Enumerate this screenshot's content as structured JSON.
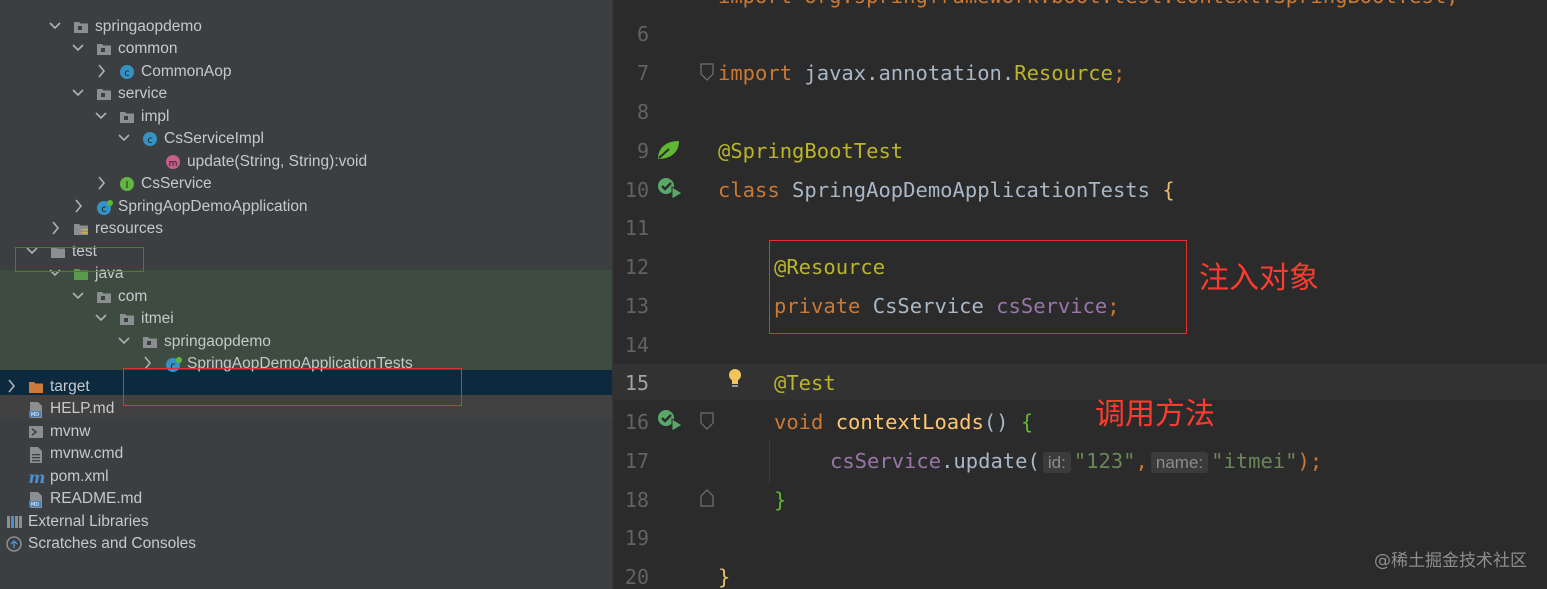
{
  "tree": {
    "items": [
      {
        "label": "springaopdemo",
        "icon": "package-icon",
        "expanded": true
      },
      {
        "label": "common",
        "icon": "package-icon",
        "expanded": true
      },
      {
        "label": "CommonAop",
        "icon": "class-icon",
        "expanded": false
      },
      {
        "label": "service",
        "icon": "package-icon",
        "expanded": true
      },
      {
        "label": "impl",
        "icon": "package-icon",
        "expanded": true
      },
      {
        "label": "CsServiceImpl",
        "icon": "class-icon",
        "expanded": true
      },
      {
        "label": "update(String, String):void",
        "icon": "method-icon"
      },
      {
        "label": "CsService",
        "icon": "interface-icon",
        "expanded": false
      },
      {
        "label": "SpringAopDemoApplication",
        "icon": "spring-boot-class-icon",
        "expanded": false
      },
      {
        "label": "resources",
        "icon": "resources-folder-icon",
        "expanded": false
      },
      {
        "label": "test",
        "icon": "folder-icon",
        "expanded": true
      },
      {
        "label": "java",
        "icon": "test-source-folder-icon",
        "expanded": true
      },
      {
        "label": "com",
        "icon": "package-icon",
        "expanded": true
      },
      {
        "label": "itmei",
        "icon": "package-icon",
        "expanded": true
      },
      {
        "label": "springaopdemo",
        "icon": "package-icon",
        "expanded": true
      },
      {
        "label": "SpringAopDemoApplicationTests",
        "icon": "test-class-icon",
        "expanded": false
      },
      {
        "label": "target",
        "icon": "excluded-folder-icon",
        "expanded": false
      },
      {
        "label": "HELP.md",
        "icon": "markdown-file-icon"
      },
      {
        "label": "mvnw",
        "icon": "shell-script-icon"
      },
      {
        "label": "mvnw.cmd",
        "icon": "text-file-icon"
      },
      {
        "label": "pom.xml",
        "icon": "maven-icon"
      },
      {
        "label": "README.md",
        "icon": "markdown-file-icon"
      },
      {
        "label": "External Libraries",
        "icon": "libraries-icon",
        "expanded": false
      },
      {
        "label": "Scratches and Consoles",
        "icon": "scratches-icon",
        "expanded": false
      }
    ]
  },
  "editor": {
    "line_numbers": [
      "6",
      "7",
      "8",
      "9",
      "10",
      "11",
      "12",
      "13",
      "14",
      "15",
      "16",
      "17",
      "18",
      "19",
      "20"
    ],
    "line5_partial": "import org.springframework.boot.test.context.SpringBootTest;",
    "l7_import": "import",
    "l7_pkg": " javax.annotation.",
    "l7_cls": "Resource",
    "l7_semi": ";",
    "l9_ann": "@SpringBootTest",
    "l10_kw": "class",
    "l10_name": " SpringAopDemoApplicationTests ",
    "l10_brace": "{",
    "l12_ann": "@Resource",
    "l13_kw": "private",
    "l13_type": " CsService ",
    "l13_field": "csService",
    "l13_semi": ";",
    "l15_at": "@",
    "l15_ann": "Test",
    "l16_kw": "void",
    "l16_meth": " contextLoads",
    "l16_rest": "() ",
    "l16_brace": "{",
    "l17_field": "csService",
    "l17_dot": ".update(",
    "l17_hint1": "id:",
    "l17_str1": "\"123\"",
    "l17_comma": ",",
    "l17_hint2": "name:",
    "l17_str2": "\"itmei\"",
    "l17_end": ");",
    "l18_brace": "}",
    "l20_brace": "}"
  },
  "annotations": {
    "inject_note": "注入对象",
    "call_note": "调用方法"
  },
  "watermark": "@稀土掘金技术社区",
  "colors": {
    "keyword": "#cc7832",
    "annotation": "#bbb529",
    "field": "#9876aa",
    "string": "#6a8759",
    "method": "#ffc66d",
    "highlight_red": "#e0312d"
  }
}
